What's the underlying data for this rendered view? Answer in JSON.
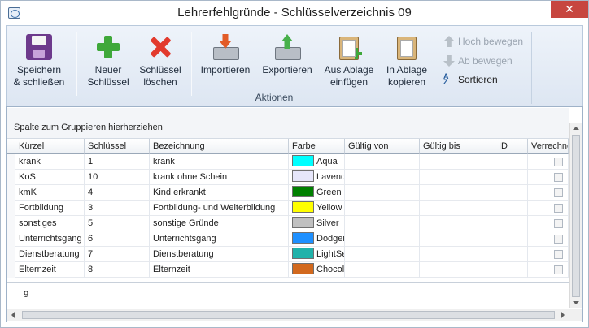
{
  "window": {
    "title": "Lehrerfehlgründe - Schlüsselverzeichnis 09",
    "close_label": "✕"
  },
  "ribbon": {
    "buttons": {
      "save": "Speichern\n& schließen",
      "new": "Neuer\nSchlüssel",
      "delete": "Schlüssel\nlöschen",
      "import": "Importieren",
      "export": "Exportieren",
      "paste": "Aus Ablage\neinfügen",
      "copy": "In Ablage\nkopieren"
    },
    "side": {
      "move_up": "Hoch bewegen",
      "move_down": "Ab bewegen",
      "sort": "Sortieren"
    },
    "group_label": "Aktionen"
  },
  "grid": {
    "group_panel_text": "Spalte zum Gruppieren hierherziehen",
    "columns": [
      "Kürzel",
      "Schlüssel",
      "Bezeichnung",
      "Farbe",
      "Gültig von",
      "Gültig bis",
      "ID",
      "Verrechnen"
    ],
    "rows": [
      {
        "kuerzel": "krank",
        "schluessel": "1",
        "bezeichnung": "krank",
        "farbe": "Aqua",
        "color": "#00ffff"
      },
      {
        "kuerzel": "KoS",
        "schluessel": "10",
        "bezeichnung": "krank ohne Schein",
        "farbe": "Lavender",
        "color": "#e6e6fa"
      },
      {
        "kuerzel": "kmK",
        "schluessel": "4",
        "bezeichnung": "Kind erkrankt",
        "farbe": "Green",
        "color": "#008000"
      },
      {
        "kuerzel": "Fortbildung",
        "schluessel": "3",
        "bezeichnung": "Fortbildung- und Weiterbildung",
        "farbe": "Yellow",
        "color": "#ffff00"
      },
      {
        "kuerzel": "sonstiges",
        "schluessel": "5",
        "bezeichnung": "sonstige Gründe",
        "farbe": "Silver",
        "color": "#c0c0c0"
      },
      {
        "kuerzel": "Unterrichtsgang",
        "schluessel": "6",
        "bezeichnung": "Unterrichtsgang",
        "farbe": "DodgerBlue",
        "color": "#1e90ff"
      },
      {
        "kuerzel": "Dienstberatung",
        "schluessel": "7",
        "bezeichnung": "Dienstberatung",
        "farbe": "LightSeaGreen",
        "color": "#20b2aa"
      },
      {
        "kuerzel": "Elternzeit",
        "schluessel": "8",
        "bezeichnung": "Elternzeit",
        "farbe": "Chocolate",
        "color": "#d2691e"
      }
    ],
    "footer_count": "9"
  }
}
